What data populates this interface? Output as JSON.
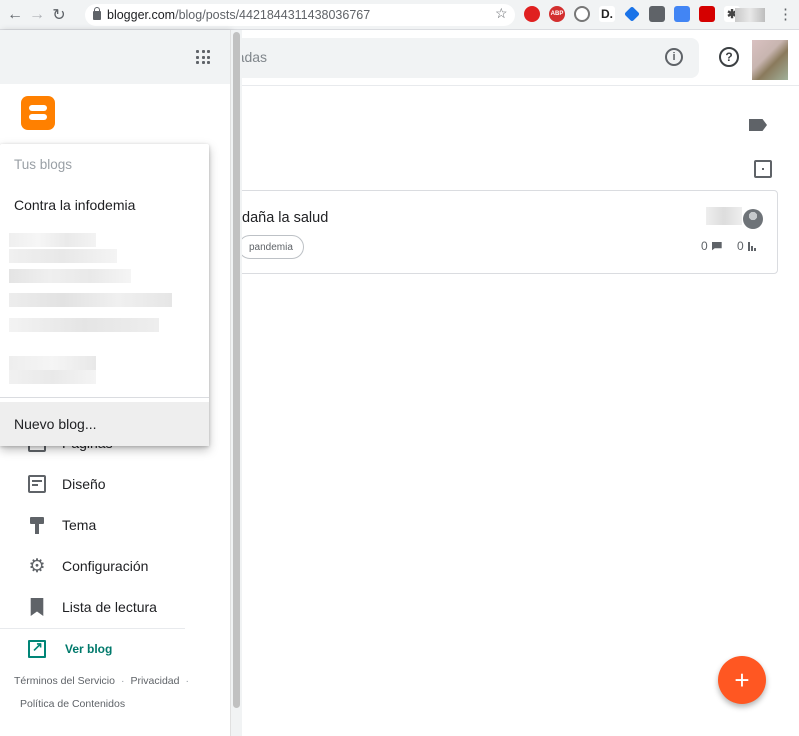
{
  "browser": {
    "url_host": "blogger.com",
    "url_path": "/blog/posts/4421844311438036767"
  },
  "header": {
    "search_placeholder_visible": "radas"
  },
  "post": {
    "title": "daña la salud",
    "tag": "pandemia",
    "comments": "0",
    "views": "0"
  },
  "sidebar": {
    "items": [
      {
        "label": "Páginas",
        "icon": "pages-icon"
      },
      {
        "label": "Diseño",
        "icon": "layout-icon"
      },
      {
        "label": "Tema",
        "icon": "theme-icon"
      },
      {
        "label": "Configuración",
        "icon": "gear-icon"
      },
      {
        "label": "Lista de lectura",
        "icon": "bookmark-icon"
      }
    ],
    "view_blog": "Ver blog",
    "footer": {
      "terms": "Términos del Servicio",
      "privacy": "Privacidad",
      "policy": "Política de Contenidos"
    }
  },
  "blog_menu": {
    "heading": "Tus blogs",
    "blogs": [
      "Contra la infodemia"
    ],
    "new_blog": "Nuevo blog..."
  },
  "colors": {
    "blogger_orange": "#ff8000",
    "fab": "#ff5722",
    "accent_teal": "#00796b"
  }
}
